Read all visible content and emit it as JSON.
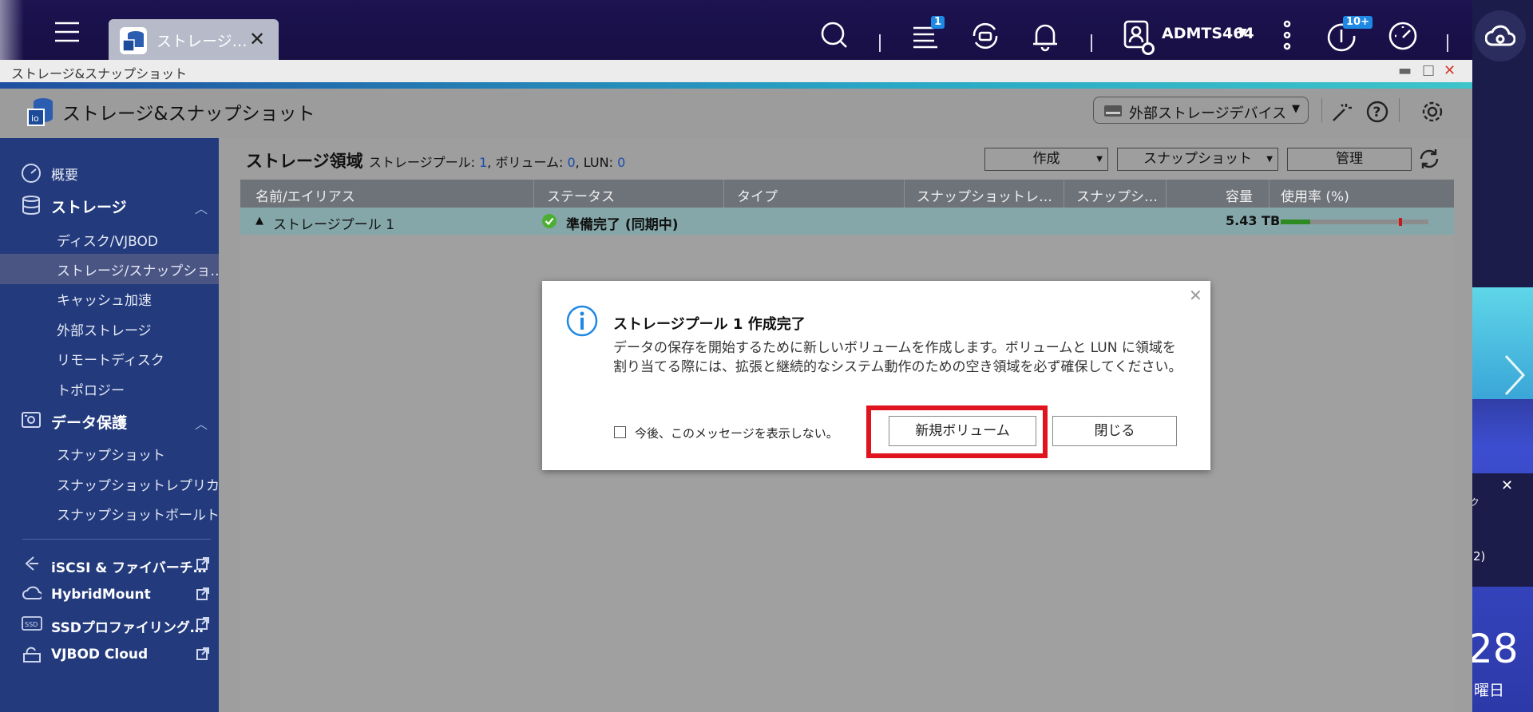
{
  "topbar": {
    "app_tab_label": "ストレージ…",
    "tasks_badge": "1",
    "user_name": "ADMTS464",
    "updates_badge": "10+",
    "icons": [
      "menu-icon",
      "storage-app-icon",
      "search-icon",
      "tasks-icon",
      "sync-icon",
      "bell-icon",
      "user-icon",
      "more-icon",
      "update-icon",
      "dashboard-icon",
      "cloud-icon"
    ]
  },
  "window": {
    "title": "ストレージ&スナップショット",
    "app_title": "ストレージ&スナップショット",
    "ext_storage_label": "外部ストレージデバイス"
  },
  "sidebar": {
    "overview": "概要",
    "storage_section": "ストレージ",
    "storage_items": [
      "ディスク/VJBOD",
      "ストレージ/スナップショ…",
      "キャッシュ加速",
      "外部ストレージ",
      "リモートディスク",
      "トポロジー"
    ],
    "protection_section": "データ保護",
    "protection_items": [
      "スナップショット",
      "スナップショットレプリカ",
      "スナップショットボールト"
    ],
    "external_links": [
      "iSCSI & ファイバーチ…",
      "HybridMount",
      "SSDプロファイリング…",
      "VJBOD Cloud"
    ]
  },
  "content": {
    "heading": "ストレージ領域",
    "pool_label": "ストレージプール: ",
    "pool_count": "1",
    "volume_label": ", ボリューム: ",
    "volume_count": "0",
    "lun_label": ", LUN: ",
    "lun_count": "0",
    "toolbar": {
      "create": "作成",
      "snapshot": "スナップショット",
      "manage": "管理"
    },
    "columns": [
      "名前/エイリアス",
      "ステータス",
      "タイプ",
      "スナップショットレ…",
      "スナップシ…",
      "容量",
      "使用率 (%)"
    ],
    "row": {
      "name": "ストレージプール 1",
      "status": "準備完了 (同期中)",
      "capacity": "5.43 TB",
      "usage_fraction": 0.2
    }
  },
  "dialog": {
    "title": "ストレージプール 1 作成完了",
    "message": "データの保存を開始するために新しいボリュームを作成します。ボリュームと LUN に領域を割り当てる際には、拡張と継続的なシステム動作のための空き領域を必ず確保してください。",
    "checkbox_label": "今後、このメッセージを表示しない。",
    "new_volume_button": "新規ボリューム",
    "close_button": "閉じる"
  },
  "desktop": {
    "date_fragment": "28",
    "dow_fragment": "曜日",
    "notification_fragment": "2)"
  },
  "colors": {
    "sidebar_bg": "#233b7d",
    "highlight": "#e0141e",
    "info_blue": "#1e88e5"
  }
}
